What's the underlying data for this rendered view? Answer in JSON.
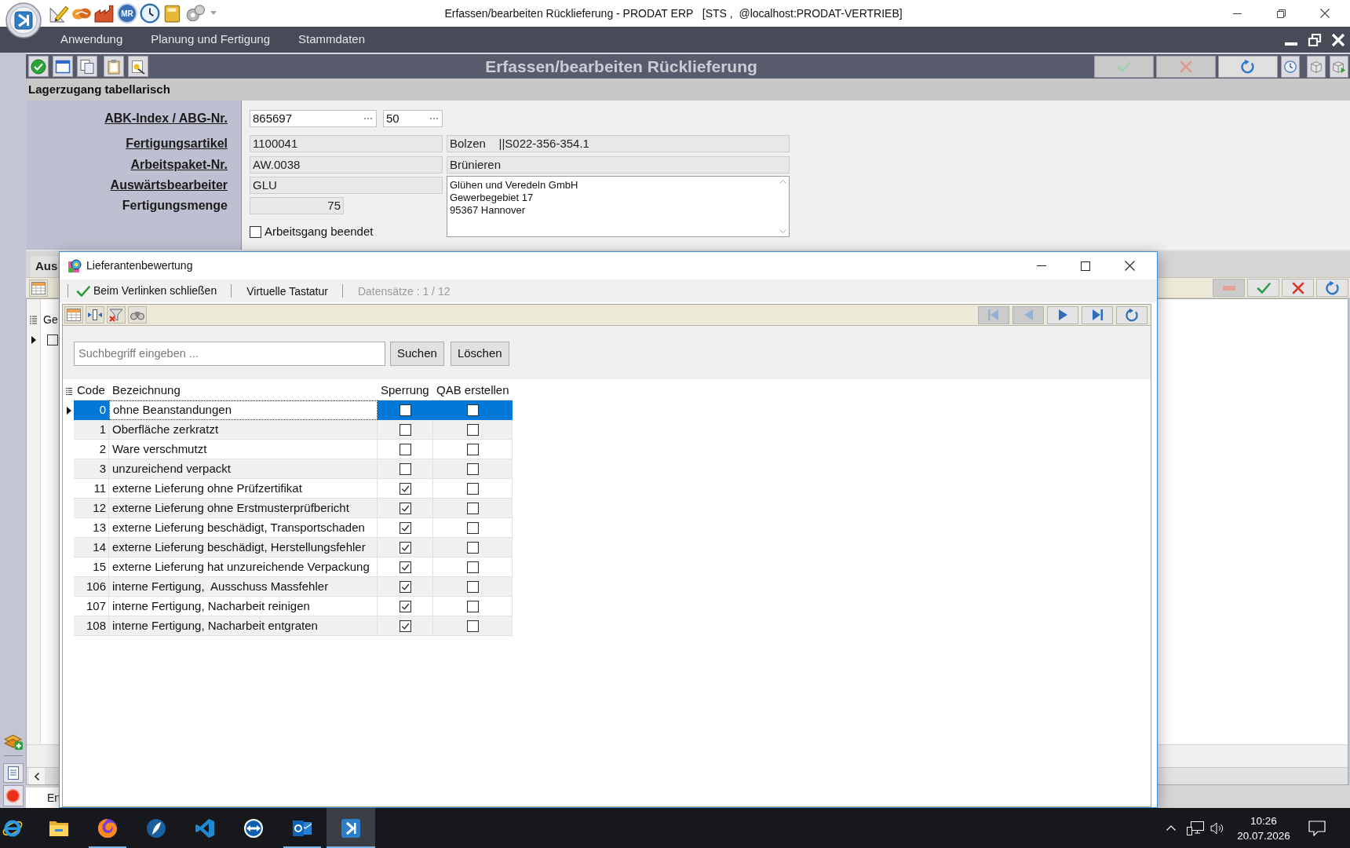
{
  "window": {
    "title": "Erfassen/bearbeiten Rücklieferung - PRODAT ERP   [STS ,  @localhost:PRODAT-VERTRIEB]"
  },
  "quick_access": {
    "badge": "MR"
  },
  "menu": [
    {
      "label": "Anwendung"
    },
    {
      "label": "Planung und Fertigung"
    },
    {
      "label": "Stammdaten"
    }
  ],
  "toolbar": {
    "title": "Erfassen/bearbeiten Rücklieferung",
    "actions": [
      {
        "kind": "confirm",
        "disabled": true
      },
      {
        "kind": "cancel",
        "disabled": true
      },
      {
        "kind": "refresh",
        "disabled": false
      }
    ]
  },
  "section": {
    "title": "Lagerzugang tabellarisch"
  },
  "form": {
    "rows": [
      {
        "kind": "lookup",
        "label": "ABK-Index / ABG-Nr.",
        "underlined": true,
        "fields": [
          "865697",
          "50"
        ]
      },
      {
        "kind": "readonly",
        "label": "Fertigungsartikel",
        "underlined": true,
        "fields": [
          "1100041",
          "Bolzen    ||S022-356-354.1"
        ]
      },
      {
        "kind": "readonly",
        "label": "Arbeitspaket-Nr.",
        "underlined": true,
        "fields": [
          "AW.0038",
          "Brünieren"
        ]
      },
      {
        "kind": "readonly",
        "label": "Auswärtsbearbeiter",
        "underlined": true,
        "fields": [
          "GLU"
        ]
      },
      {
        "kind": "number",
        "label": "Fertigungsmenge",
        "underlined": false,
        "fields": [
          "75"
        ]
      }
    ],
    "address": [
      "Glühen und Veredeln GmbH",
      "Gewerbegebiet 17",
      "95367 Hannover"
    ],
    "checkbox": {
      "label": "Arbeitsgang beendet",
      "checked": false
    }
  },
  "lower_panel": {
    "tab": "Aus",
    "column_1": "Ge",
    "row_checked": false,
    "bottom_tab": "En",
    "actions": [
      {
        "kind": "remove",
        "disabled": true
      },
      {
        "kind": "confirm",
        "disabled": false
      },
      {
        "kind": "cancel",
        "disabled": false
      },
      {
        "kind": "refresh",
        "disabled": false
      }
    ]
  },
  "dialog": {
    "title": "Lieferantenbewertung",
    "actions": [
      {
        "kind": "check",
        "label": "Beim Verlinken schließen"
      },
      {
        "kind": "button",
        "label": "Virtuelle Tastatur"
      },
      {
        "kind": "info",
        "label": "Datensätze : 1 / 12"
      }
    ],
    "navigation": [
      {
        "kind": "first",
        "disabled": true
      },
      {
        "kind": "previous",
        "disabled": true
      },
      {
        "kind": "next",
        "disabled": false
      },
      {
        "kind": "last",
        "disabled": false
      },
      {
        "kind": "refresh",
        "disabled": false
      }
    ],
    "search": {
      "placeholder": "Suchbegriff eingeben ...",
      "buttons": [
        "Suchen",
        "Löschen"
      ]
    },
    "table": {
      "columns": [
        "Code",
        "Bezeichnung",
        "Sperrung",
        "QAB erstellen"
      ],
      "rows": [
        {
          "code": "0",
          "name": "ohne Beanstandungen",
          "sperrung": false,
          "qab": false,
          "selected": true
        },
        {
          "code": "1",
          "name": "Oberfläche zerkratzt",
          "sperrung": false,
          "qab": false,
          "selected": false
        },
        {
          "code": "2",
          "name": "Ware verschmutzt",
          "sperrung": false,
          "qab": false,
          "selected": false
        },
        {
          "code": "3",
          "name": "unzureichend verpackt",
          "sperrung": false,
          "qab": false,
          "selected": false
        },
        {
          "code": "11",
          "name": "externe Lieferung ohne Prüfzertifikat",
          "sperrung": true,
          "qab": false,
          "selected": false
        },
        {
          "code": "12",
          "name": "externe Lieferung ohne Erstmusterprüfbericht",
          "sperrung": true,
          "qab": false,
          "selected": false
        },
        {
          "code": "13",
          "name": "externe Lieferung beschädigt, Transportschaden",
          "sperrung": true,
          "qab": false,
          "selected": false
        },
        {
          "code": "14",
          "name": "externe Lieferung beschädigt, Herstellungsfehler",
          "sperrung": true,
          "qab": false,
          "selected": false
        },
        {
          "code": "15",
          "name": "externe Lieferung hat unzureichende Verpackung",
          "sperrung": true,
          "qab": false,
          "selected": false
        },
        {
          "code": "106",
          "name": "interne Fertigung,  Ausschuss Massfehler",
          "sperrung": true,
          "qab": false,
          "selected": false
        },
        {
          "code": "107",
          "name": "interne Fertigung, Nacharbeit reinigen",
          "sperrung": true,
          "qab": false,
          "selected": false
        },
        {
          "code": "108",
          "name": "interne Fertigung, Nacharbeit entgraten",
          "sperrung": true,
          "qab": false,
          "selected": false
        }
      ]
    }
  },
  "taskbar": {
    "apps": [
      {
        "running": false,
        "active": false
      },
      {
        "running": false,
        "active": false
      },
      {
        "running": true,
        "active": false
      },
      {
        "running": false,
        "active": false
      },
      {
        "running": false,
        "active": false
      },
      {
        "running": false,
        "active": false
      },
      {
        "running": true,
        "active": false
      },
      {
        "running": true,
        "active": true
      }
    ],
    "time": "10:26",
    "date": "20.07.2026"
  }
}
